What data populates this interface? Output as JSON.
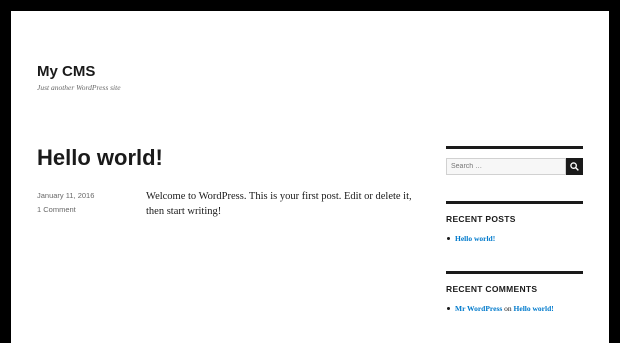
{
  "site": {
    "title": "My CMS",
    "description": "Just another WordPress site"
  },
  "post": {
    "title": "Hello world!",
    "date": "January 11, 2016",
    "comments_link": "1 Comment",
    "content": "Welcome to WordPress. This is your first post. Edit or delete it, then start writing!"
  },
  "sidebar": {
    "search": {
      "placeholder": "Search …",
      "icon": "search-icon"
    },
    "recent_posts": {
      "title": "RECENT POSTS",
      "items": [
        {
          "label": "Hello world!"
        }
      ]
    },
    "recent_comments": {
      "title": "RECENT COMMENTS",
      "items": [
        {
          "author": "Mr WordPress",
          "connector": "on",
          "post": "Hello world!"
        }
      ]
    }
  },
  "colors": {
    "frame": "#000000",
    "text": "#1a1a1a",
    "muted": "#686868",
    "link": "#007acc"
  }
}
